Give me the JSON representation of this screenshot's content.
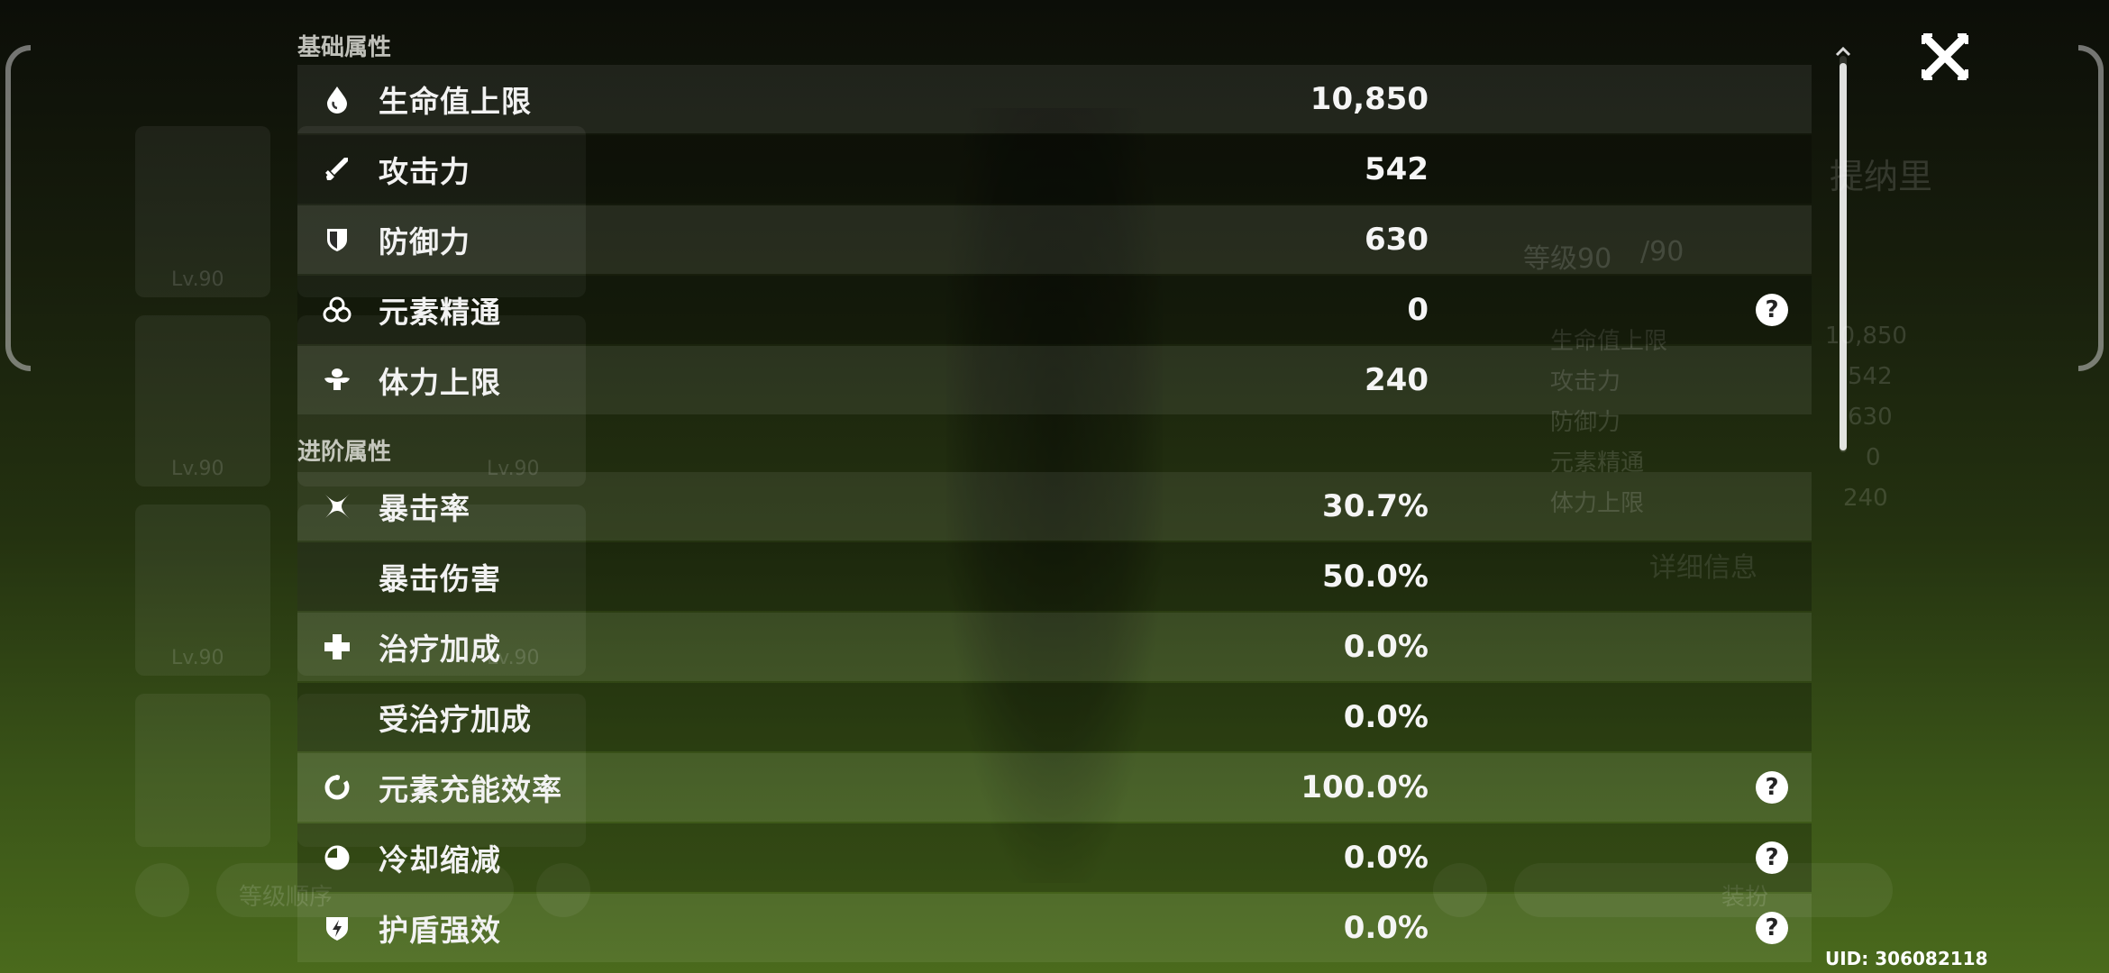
{
  "background": {
    "character_name": "提纳里",
    "level_text": "等级90",
    "level_max": "/90",
    "detail_button": "详细信息",
    "list_levels": [
      "Lv.90",
      "Lv.90",
      "Lv.90",
      "Lv.90",
      "Lv.90"
    ],
    "mini_stats": [
      {
        "label": "生命值上限",
        "value": "10,850"
      },
      {
        "label": "攻击力",
        "value": "542"
      },
      {
        "label": "防御力",
        "value": "630"
      },
      {
        "label": "元素精通",
        "value": "0"
      },
      {
        "label": "体力上限",
        "value": "240"
      }
    ],
    "sort_label": "等级顺序",
    "bottom_right_label": "装扮"
  },
  "sections": {
    "base_title": "基础属性",
    "advanced_title": "进阶属性"
  },
  "stats": [
    {
      "icon": "hp-drop-icon",
      "label": "生命值上限",
      "value": "10,850",
      "help": false
    },
    {
      "icon": "sword-icon",
      "label": "攻击力",
      "value": "542",
      "help": false
    },
    {
      "icon": "shield-icon",
      "label": "防御力",
      "value": "630",
      "help": false
    },
    {
      "icon": "elemental-mastery-icon",
      "label": "元素精通",
      "value": "0",
      "help": true
    },
    {
      "icon": "stamina-icon",
      "label": "体力上限",
      "value": "240",
      "help": false
    },
    {
      "icon": "crit-rate-icon",
      "label": "暴击率",
      "value": "30.7%",
      "help": false
    },
    {
      "icon": "",
      "label": "暴击伤害",
      "value": "50.0%",
      "help": false
    },
    {
      "icon": "healing-cross-icon",
      "label": "治疗加成",
      "value": "0.0%",
      "help": false
    },
    {
      "icon": "",
      "label": "受治疗加成",
      "value": "0.0%",
      "help": false
    },
    {
      "icon": "energy-recharge-icon",
      "label": "元素充能效率",
      "value": "100.0%",
      "help": true
    },
    {
      "icon": "cooldown-icon",
      "label": "冷却缩减",
      "value": "0.0%",
      "help": true
    },
    {
      "icon": "shield-strength-icon",
      "label": "护盾强效",
      "value": "0.0%",
      "help": true
    }
  ],
  "help_glyph": "?",
  "uid": "UID: 306082118"
}
